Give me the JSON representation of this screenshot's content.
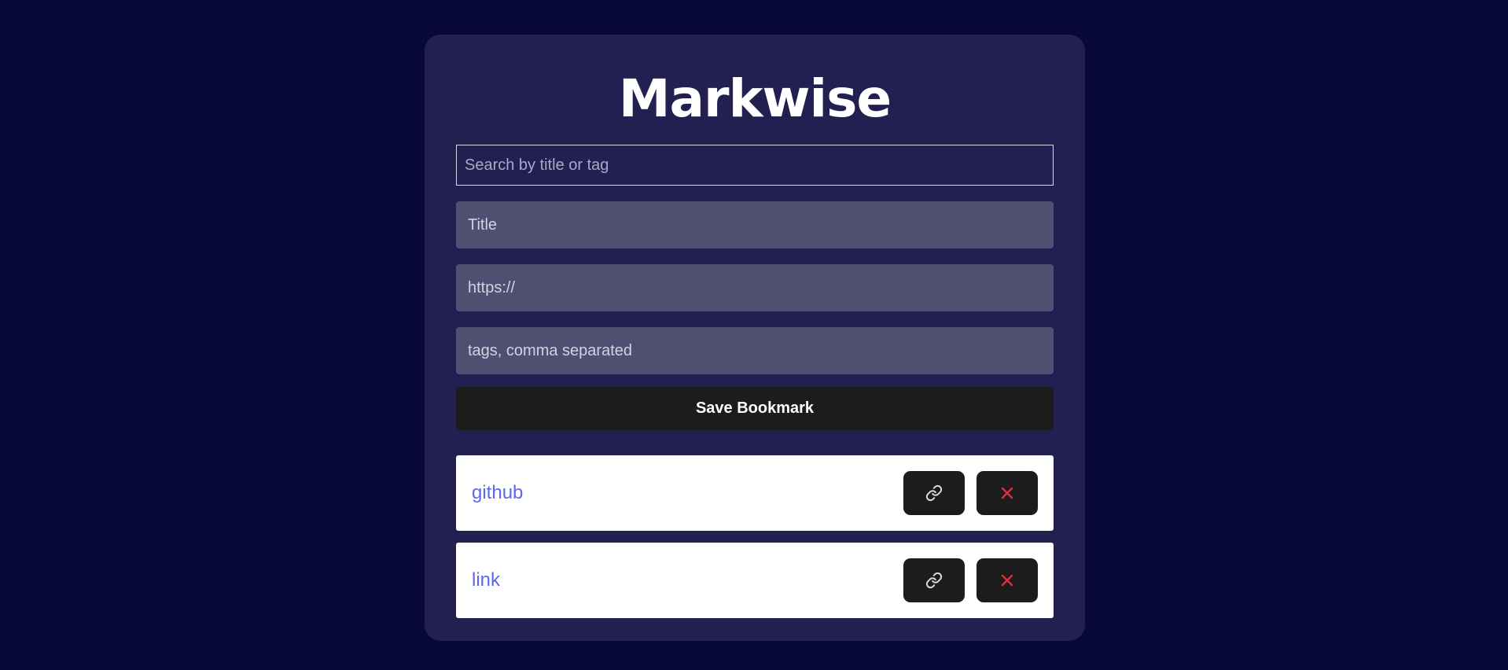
{
  "app": {
    "title": "Markwise"
  },
  "search": {
    "placeholder": "Search by title or tag",
    "value": ""
  },
  "form": {
    "title_placeholder": "Title",
    "url_placeholder": "https://",
    "tags_placeholder": "tags, comma separated",
    "save_label": "Save Bookmark"
  },
  "bookmarks": [
    {
      "title": "github",
      "open_icon": "link-icon",
      "delete_icon": "close-icon"
    },
    {
      "title": "link",
      "open_icon": "link-icon",
      "delete_icon": "close-icon"
    }
  ],
  "colors": {
    "page_background": "#070838",
    "card_background": "#212050",
    "input_background": "#504f72",
    "button_background": "#1c1c1c",
    "bookmark_title": "#5a67f0",
    "delete_icon": "#e0303a"
  }
}
